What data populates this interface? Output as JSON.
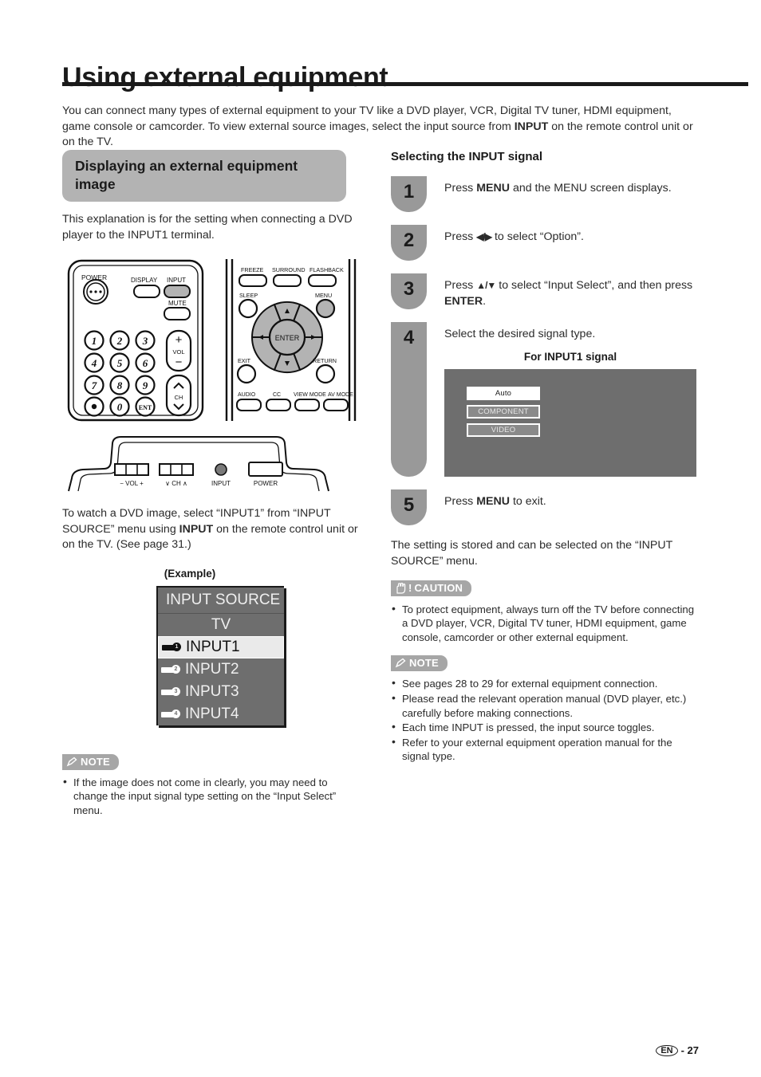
{
  "page": {
    "title": "Using external equipment",
    "intro": "You can connect many types of external equipment to your TV like a DVD player, VCR, Digital TV tuner, HDMI equipment, game console or camcorder. To view external source images, select the input source from ",
    "intro_bold": "INPUT",
    "intro_tail": " on the remote control unit or on the TV.",
    "footer_lang": "EN",
    "footer_page": "- 27"
  },
  "left": {
    "section_heading": "Displaying an external equipment image",
    "paragraph1": "This explanation is for the setting when connecting a DVD player to the INPUT1 terminal.",
    "paragraph2_a": "To watch a DVD image, select “INPUT1” from “INPUT SOURCE” menu using ",
    "paragraph2_b": "INPUT",
    "paragraph2_c": " on the remote control unit or on the TV. (See page 31.)",
    "example_label": "(Example)",
    "osd": {
      "title": "INPUT SOURCE",
      "rows": [
        {
          "label": "TV",
          "icon": "",
          "selected": false
        },
        {
          "label": "INPUT1",
          "icon": "plug-1-icon",
          "selected": true
        },
        {
          "label": "INPUT2",
          "icon": "plug-2-icon",
          "selected": false
        },
        {
          "label": "INPUT3",
          "icon": "plug-3-icon",
          "selected": false
        },
        {
          "label": "INPUT4",
          "icon": "plug-4-icon",
          "selected": false
        }
      ]
    },
    "note": {
      "badge": "NOTE",
      "items": [
        "If the image does not come in clearly, you may need to change the input signal type setting on the “Input Select” menu."
      ]
    },
    "remote": {
      "power_label": "POWER",
      "display_label": "DISPLAY",
      "input_label": "INPUT",
      "mute_label": "MUTE",
      "vol_label": "VOL",
      "ch_label": "CH",
      "keys": [
        "1",
        "2",
        "3",
        "4",
        "5",
        "6",
        "7",
        "8",
        "9",
        "•",
        "0",
        "ENT"
      ],
      "freeze_label": "FREEZE",
      "surround_label": "SURROUND",
      "flashback_label": "FLASHBACK",
      "sleep_label": "SLEEP",
      "menu_label": "MENU",
      "enter_label": "ENTER",
      "exit_label": "EXIT",
      "return_label": "RETURN",
      "audio_label": "AUDIO",
      "cc_label": "CC",
      "viewmode_label": "VIEW MODE",
      "avmode_label": "AV MODE"
    },
    "tv_panel": {
      "vol_label": "− VOL +",
      "ch_label": "∨ CH ∧",
      "input_label": "INPUT",
      "power_label": "POWER"
    }
  },
  "right": {
    "sub_heading": "Selecting the INPUT signal",
    "steps": [
      {
        "num": "1",
        "text_a": "Press ",
        "bold": "MENU",
        "text_b": " and the MENU screen displays."
      },
      {
        "num": "2",
        "text_a": "Press ",
        "bold": "◀/▶",
        "text_b": " to select “Option”."
      },
      {
        "num": "3",
        "text_a": "Press ",
        "bold": "▲/▼",
        "text_b": " to select “Input Select”, and then press ",
        "bold2": "ENTER",
        "text_c": "."
      },
      {
        "num": "4",
        "text_a": "Select the desired signal type."
      },
      {
        "num": "5",
        "text_a": "Press ",
        "bold": "MENU",
        "text_b": " to exit."
      }
    ],
    "signal_title": "For INPUT1 signal",
    "signal_options": [
      {
        "label": "Auto",
        "selected": true
      },
      {
        "label": "COMPONENT",
        "selected": false
      },
      {
        "label": "VIDEO",
        "selected": false
      }
    ],
    "closing": "The setting is stored and can be selected on the “INPUT SOURCE” menu.",
    "caution": {
      "badge": "CAUTION",
      "items": [
        "To protect equipment, always turn off the TV before connecting a DVD player, VCR, Digital TV tuner, HDMI equipment, game console, camcorder or other external equipment."
      ]
    },
    "note": {
      "badge": "NOTE",
      "items": [
        "See pages 28 to 29 for external equipment connection.",
        "Please read the relevant operation manual (DVD player, etc.) carefully before making connections.",
        "Each time INPUT is pressed, the input source toggles.",
        "Refer to your external equipment operation manual for the signal type."
      ]
    }
  }
}
